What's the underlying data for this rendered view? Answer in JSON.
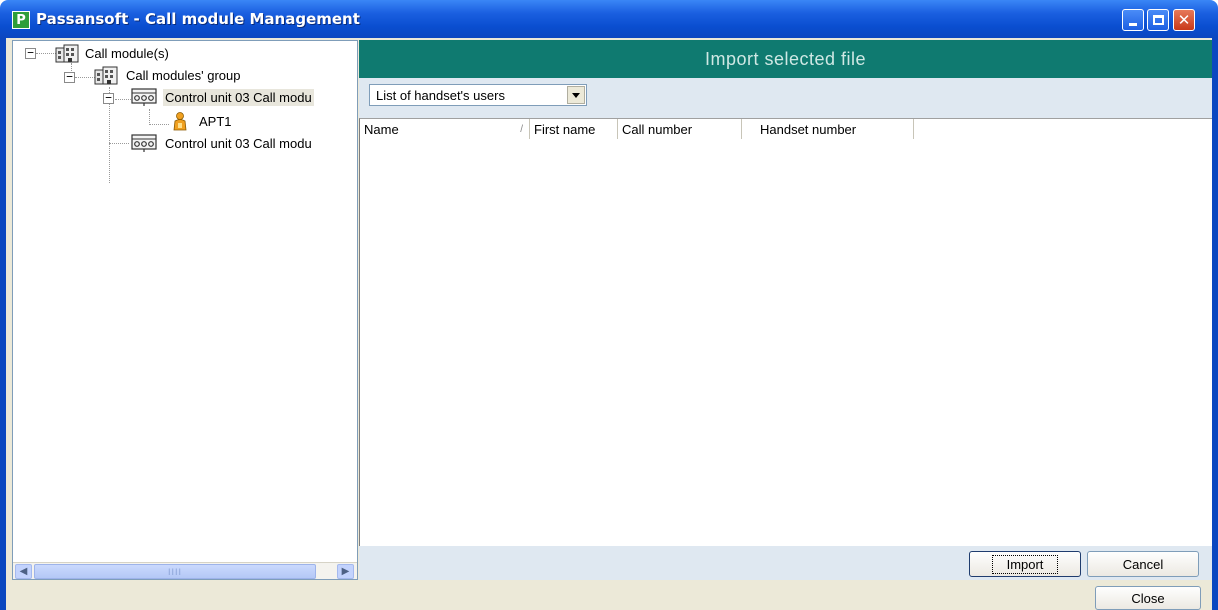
{
  "window": {
    "title": "Passansoft - Call module Management",
    "app_icon_letter": "P",
    "title_color": "#0b47c0"
  },
  "tree": {
    "root": {
      "label": "Call module(s)",
      "icon": "building-icon",
      "expander": "−"
    },
    "group": {
      "label": "Call modules' group",
      "icon": "building-icon",
      "expander": "−"
    },
    "unit_1": {
      "label": "Control unit 03 Call modu",
      "icon": "control-unit-icon",
      "expander": "−"
    },
    "user_1": {
      "label": "APT1",
      "icon": "user-icon"
    },
    "unit_2": {
      "label": "Control unit 03 Call modu",
      "icon": "control-unit-icon"
    },
    "scroll_thumb": "IIII"
  },
  "main": {
    "header": "Import selected file",
    "header_color": "#0f7a70",
    "list_type": {
      "value": "List of handset's users"
    },
    "columns": [
      {
        "label": "Name",
        "sort": "/"
      },
      {
        "label": "First name"
      },
      {
        "label": "Call number"
      },
      {
        "label": "Handset number"
      }
    ],
    "rows": []
  },
  "buttons": {
    "import": "Import",
    "cancel": "Cancel",
    "close": "Close"
  }
}
